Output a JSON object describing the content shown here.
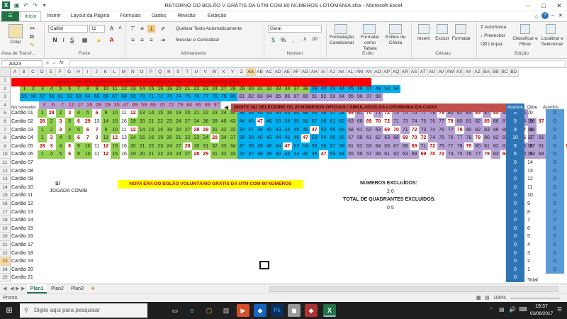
{
  "window": {
    "title": "RETORNO DO BOLÃO V GRÁTIS DA UTM COM 80 NÚMEROS LOTOMANIA.xlsx - Microsoft Excel"
  },
  "menu_tabs": [
    "Início",
    "Inserir",
    "Layout da Página",
    "Fórmulas",
    "Dados",
    "Revisão",
    "Exibição"
  ],
  "ribbon": {
    "clipboard": {
      "paste": "Colar",
      "label": "Área de Transf..."
    },
    "font": {
      "name": "Calibri",
      "size": "11",
      "label": "Fonte"
    },
    "alignment": {
      "wrap": "Quebrar Texto Automaticamente",
      "merge": "Mesclar e Centralizar",
      "label": "Alinhamento"
    },
    "number": {
      "format": "Geral",
      "label": "Número"
    },
    "styles": {
      "cond": "Formatação Condicional",
      "table": "Formatar como Tabela",
      "cell": "Estilos de Célula",
      "label": "Estilo"
    },
    "cells": {
      "insert": "Inserir",
      "delete": "Excluir",
      "format": "Formatar",
      "label": "Células"
    },
    "editing": {
      "autosum": "AutoSoma",
      "fill": "Preencher",
      "clear": "Limpar",
      "sort": "Classificar e Filtrar",
      "find": "Localizar e Selecionar",
      "label": "Edição"
    }
  },
  "namebox": "AA23",
  "fx": "fx",
  "col_headers": [
    "A",
    "B",
    "C",
    "D",
    "E",
    "F",
    "G",
    "H",
    "I",
    "J",
    "K",
    "L",
    "M",
    "N",
    "O",
    "P",
    "Q",
    "R",
    "S",
    "T",
    "U",
    "V",
    "W",
    "X",
    "Y",
    "Z",
    "AA",
    "AB",
    "AC",
    "AD",
    "AE",
    "AF",
    "AG",
    "AH",
    "AI",
    "AJ",
    "AK",
    "AL",
    "AM",
    "AN",
    "AO",
    "AP",
    "AQ",
    "AR",
    "AS",
    "AT",
    "AU",
    "AV",
    "AW",
    "AX",
    "AY",
    "AZ",
    "BA",
    "BB",
    "BC",
    "BD"
  ],
  "row_headers": [
    "1",
    "2",
    "3",
    "4",
    "5",
    "6",
    "7",
    "8",
    "9",
    "10",
    "11",
    "12",
    "13",
    "14",
    "15",
    "16",
    "17",
    "18",
    "19",
    "20",
    "21",
    "22",
    "23",
    "24",
    "25"
  ],
  "banner1": "JOGOS SIMPLIFICADOS DA LOTOMANIA COM 80 NÚMEROS  4/4  E 3/3 SEM N/SEIXOS",
  "banner1_right": "2/2  2/2",
  "row2": [
    "1",
    "2",
    "3",
    "4",
    "5",
    "6",
    "7",
    "8",
    "9",
    "10",
    "11",
    "12",
    "13",
    "14",
    "15",
    "16",
    "19",
    "20",
    "21",
    "22",
    "23",
    "24",
    "27",
    "28",
    "29",
    "30",
    "31",
    "32",
    "33",
    "34",
    "37",
    "38",
    "39",
    "40",
    "43",
    "44",
    "45",
    "46",
    "47",
    "48",
    "53",
    "54"
  ],
  "row3": [
    "55",
    "56",
    "57",
    "58",
    "61",
    "62",
    "63",
    "64",
    "65",
    "66",
    "67",
    "68",
    "69",
    "70",
    "71",
    "72",
    "73",
    "74",
    "75",
    "76",
    "77",
    "78",
    "79",
    "80",
    "81",
    "82",
    "83",
    "84",
    "85",
    "86",
    "87",
    "88",
    "91",
    "92",
    "93",
    "94",
    "95",
    "96",
    "97",
    "98"
  ],
  "row4_label": "N/s Sorteados",
  "row4": [
    "3",
    "6",
    "7",
    "12",
    "17",
    "26",
    "28",
    "29",
    "35",
    "47",
    "49",
    "59",
    "69",
    "70",
    "72",
    "79",
    "84",
    "85",
    "89",
    "97"
  ],
  "instruction": "DIGITE OU SELECIONE OS 20 NÚMEROS OFICIAIS / SIMULADOS DA LOTOMANIA DA CAIXA",
  "hdr_acertos": "Acertos",
  "hdr_qtde": "Qtde",
  "hdr_acertos2": "Acertos",
  "cards": [
    {
      "name": "Cartão 01",
      "nums": [
        "1",
        "28",
        "2",
        "3",
        "4",
        "5",
        "6",
        "9",
        "10",
        "11",
        "12",
        "13",
        "14",
        "15",
        "16",
        "19",
        "20",
        "21",
        "22",
        "23",
        "24",
        "34",
        "38",
        "39",
        "40",
        "43",
        "44",
        "45",
        "46",
        "48",
        "55",
        "56",
        "57",
        "58",
        "69",
        "61",
        "70",
        "71",
        "72",
        "73",
        "75",
        "76",
        "77",
        "78",
        "79",
        "80",
        "82",
        "83",
        "84",
        "87",
        "85",
        "92",
        "93",
        "96"
      ],
      "ac": "6"
    },
    {
      "name": "Cartão 02",
      "nums": [
        "28",
        "2",
        "3",
        "5",
        "6",
        "29",
        "13",
        "14",
        "15",
        "16",
        "19",
        "20",
        "21",
        "22",
        "23",
        "24",
        "27",
        "34",
        "38",
        "39",
        "40",
        "43",
        "44",
        "45",
        "47",
        "46",
        "53",
        "54",
        "55",
        "56",
        "57",
        "58",
        "61",
        "62",
        "63",
        "68",
        "69",
        "70",
        "72",
        "71",
        "73",
        "74",
        "75",
        "76",
        "77",
        "79",
        "80",
        "81",
        "82",
        "85",
        "86",
        "87",
        "88",
        "94",
        "96",
        "97"
      ],
      "ac": "9"
    },
    {
      "name": "Cartão 03",
      "nums": [
        "1",
        "2",
        "3",
        "4",
        "5",
        "6",
        "7",
        "9",
        "10",
        "11",
        "12",
        "14",
        "15",
        "16",
        "19",
        "20",
        "27",
        "28",
        "29",
        "31",
        "32",
        "33",
        "34",
        "37",
        "38",
        "40",
        "43",
        "44",
        "45",
        "46",
        "47",
        "53",
        "55",
        "56",
        "58",
        "61",
        "62",
        "63",
        "69",
        "70",
        "71",
        "72",
        "73",
        "74",
        "76",
        "77",
        "79",
        "80",
        "82",
        "83",
        "86",
        "88",
        "91",
        "97",
        "98"
      ],
      "ac": "9"
    },
    {
      "name": "Cartão 04",
      "nums": [
        "1",
        "3",
        "4",
        "5",
        "6",
        "7",
        "9",
        "11",
        "12",
        "13",
        "14",
        "15",
        "16",
        "19",
        "20",
        "21",
        "22",
        "23",
        "24",
        "28",
        "34",
        "37",
        "38",
        "39",
        "40",
        "43",
        "44",
        "45",
        "46",
        "47",
        "53",
        "54",
        "55",
        "56",
        "57",
        "58",
        "61",
        "62",
        "63",
        "68",
        "69",
        "70",
        "72",
        "74",
        "75",
        "76",
        "77",
        "78",
        "79",
        "80",
        "82",
        "83",
        "84",
        "85",
        "87",
        "91",
        "92",
        "97"
      ],
      "ac": "10"
    },
    {
      "name": "Cartão 05",
      "nums": [
        "28",
        "3",
        "4",
        "6",
        "9",
        "10",
        "11",
        "12",
        "15",
        "16",
        "20",
        "21",
        "22",
        "23",
        "24",
        "27",
        "28",
        "30",
        "31",
        "32",
        "33",
        "34",
        "37",
        "38",
        "39",
        "40",
        "44",
        "47",
        "53",
        "54",
        "55",
        "56",
        "57",
        "58",
        "61",
        "62",
        "63",
        "64",
        "65",
        "67",
        "68",
        "69",
        "71",
        "72",
        "75",
        "77",
        "78",
        "79",
        "80",
        "81",
        "82",
        "83",
        "84",
        "86",
        "87",
        "91",
        "92",
        "93",
        "97"
      ],
      "ac": "8"
    },
    {
      "name": "Cartão 06",
      "nums": [
        "1",
        "4",
        "5",
        "6",
        "9",
        "10",
        "11",
        "12",
        "15",
        "16",
        "19",
        "20",
        "21",
        "22",
        "23",
        "24",
        "27",
        "28",
        "29",
        "31",
        "32",
        "33",
        "34",
        "37",
        "38",
        "39",
        "40",
        "43",
        "44",
        "45",
        "46",
        "47",
        "53",
        "54",
        "55",
        "56",
        "57",
        "58",
        "61",
        "62",
        "63",
        "68",
        "69",
        "70",
        "72",
        "74",
        "75",
        "76",
        "77",
        "79",
        "83",
        "84",
        "85",
        "88",
        "93",
        "94",
        "96",
        "97"
      ],
      "ac": "6"
    }
  ],
  "card_names_empty": [
    "Cartão 07",
    "Cartão 08",
    "Cartão 09",
    "Cartão 10",
    "Cartão 11",
    "Cartão 12",
    "Cartão 13",
    "Cartão 14",
    "Cartão 15",
    "Cartão 16",
    "Cartão 17",
    "Cartão 18",
    "Cartão 19",
    "Cartão 20",
    "Cartão 21",
    "Cartão 22"
  ],
  "zeros_ac": "0",
  "qtde": [
    "20",
    "19",
    "18",
    "17",
    "16",
    "15",
    "14",
    "13",
    "12",
    "11",
    "10",
    "9",
    "8",
    "7",
    "6",
    "5",
    "4",
    "3",
    "2",
    "1",
    "0"
  ],
  "acertos_col": [
    "0",
    "0",
    "0",
    "0",
    "0",
    "0",
    "0",
    "0",
    "0",
    "0",
    "0",
    "0",
    "0",
    "0",
    "0",
    "0",
    "0",
    "0",
    "0",
    "0",
    "0"
  ],
  "total": "Total",
  "label_s": "S/",
  "label_jogada": "JOGADA COM/B",
  "promo": "NOVA ERA DO BOLÃO VOLUNTÁRIO GRÁTIS DA UTM COM 80 NÚMEROS",
  "num_excluidos": "NÚMEROS EXCLUÍDOS:",
  "num_excluidos_val": "2 0",
  "quad_excluidos": "TOTAL DE QUADRANTES EXCLUÍDOS:",
  "quad_excluidos_val": "0 5",
  "sheets": [
    "Plan1",
    "Plan2",
    "Plan3"
  ],
  "status": {
    "mode": "Pronto",
    "zoom": "100%"
  },
  "taskbar": {
    "search": "Digite aqui para pesquisar",
    "time": "19:37",
    "date": "03/06/2017"
  },
  "colors": {
    "red": "#ff0000",
    "green": "#92d050",
    "blue": "#00b0f0",
    "purple": "#b4a0d4",
    "darkblue": "#2e75b6"
  }
}
